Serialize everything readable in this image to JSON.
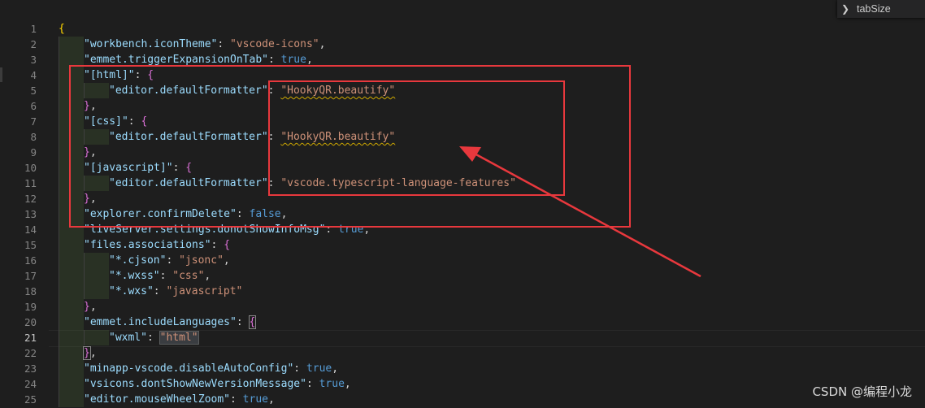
{
  "find_widget": {
    "query": "tabSize"
  },
  "lines": [
    {
      "n": "1",
      "indent": 0,
      "tokens": [
        {
          "t": "{",
          "c": "b1"
        }
      ]
    },
    {
      "n": "2",
      "indent": 1,
      "tokens": [
        {
          "t": "\"workbench.iconTheme\"",
          "c": "k"
        },
        {
          "t": ": ",
          "c": "p"
        },
        {
          "t": "\"vscode-icons\"",
          "c": "s"
        },
        {
          "t": ",",
          "c": "p"
        }
      ]
    },
    {
      "n": "3",
      "indent": 1,
      "tokens": [
        {
          "t": "\"emmet.triggerExpansionOnTab\"",
          "c": "k"
        },
        {
          "t": ": ",
          "c": "p"
        },
        {
          "t": "true",
          "c": "c"
        },
        {
          "t": ",",
          "c": "p"
        }
      ]
    },
    {
      "n": "4",
      "indent": 1,
      "tokens": [
        {
          "t": "\"[html]\"",
          "c": "k"
        },
        {
          "t": ": ",
          "c": "p"
        },
        {
          "t": "{",
          "c": "b2"
        }
      ]
    },
    {
      "n": "5",
      "indent": 2,
      "tokens": [
        {
          "t": "\"editor.defaultFormatter\"",
          "c": "k"
        },
        {
          "t": ": ",
          "c": "p"
        },
        {
          "t": "\"HookyQR.beautify\"",
          "c": "s squig"
        }
      ]
    },
    {
      "n": "6",
      "indent": 1,
      "tokens": [
        {
          "t": "}",
          "c": "b2"
        },
        {
          "t": ",",
          "c": "p"
        }
      ]
    },
    {
      "n": "7",
      "indent": 1,
      "tokens": [
        {
          "t": "\"[css]\"",
          "c": "k"
        },
        {
          "t": ": ",
          "c": "p"
        },
        {
          "t": "{",
          "c": "b2"
        }
      ]
    },
    {
      "n": "8",
      "indent": 2,
      "tokens": [
        {
          "t": "\"editor.defaultFormatter\"",
          "c": "k"
        },
        {
          "t": ": ",
          "c": "p"
        },
        {
          "t": "\"HookyQR.beautify\"",
          "c": "s squig"
        }
      ]
    },
    {
      "n": "9",
      "indent": 1,
      "tokens": [
        {
          "t": "}",
          "c": "b2"
        },
        {
          "t": ",",
          "c": "p"
        }
      ]
    },
    {
      "n": "10",
      "indent": 1,
      "tokens": [
        {
          "t": "\"[javascript]\"",
          "c": "k"
        },
        {
          "t": ": ",
          "c": "p"
        },
        {
          "t": "{",
          "c": "b2"
        }
      ]
    },
    {
      "n": "11",
      "indent": 2,
      "tokens": [
        {
          "t": "\"editor.defaultFormatter\"",
          "c": "k"
        },
        {
          "t": ": ",
          "c": "p"
        },
        {
          "t": "\"vscode.typescript-language-features\"",
          "c": "s"
        }
      ]
    },
    {
      "n": "12",
      "indent": 1,
      "tokens": [
        {
          "t": "}",
          "c": "b2"
        },
        {
          "t": ",",
          "c": "p"
        }
      ]
    },
    {
      "n": "13",
      "indent": 1,
      "tokens": [
        {
          "t": "\"explorer.confirmDelete\"",
          "c": "k"
        },
        {
          "t": ": ",
          "c": "p"
        },
        {
          "t": "false",
          "c": "c"
        },
        {
          "t": ",",
          "c": "p"
        }
      ]
    },
    {
      "n": "14",
      "indent": 1,
      "tokens": [
        {
          "t": "\"liveServer.settings.donotShowInfoMsg\"",
          "c": "k"
        },
        {
          "t": ": ",
          "c": "p"
        },
        {
          "t": "true",
          "c": "c"
        },
        {
          "t": ",",
          "c": "p"
        }
      ]
    },
    {
      "n": "15",
      "indent": 1,
      "tokens": [
        {
          "t": "\"files.associations\"",
          "c": "k"
        },
        {
          "t": ": ",
          "c": "p"
        },
        {
          "t": "{",
          "c": "b2"
        }
      ]
    },
    {
      "n": "16",
      "indent": 2,
      "tokens": [
        {
          "t": "\"*.cjson\"",
          "c": "k"
        },
        {
          "t": ": ",
          "c": "p"
        },
        {
          "t": "\"jsonc\"",
          "c": "s"
        },
        {
          "t": ",",
          "c": "p"
        }
      ]
    },
    {
      "n": "17",
      "indent": 2,
      "tokens": [
        {
          "t": "\"*.wxss\"",
          "c": "k"
        },
        {
          "t": ": ",
          "c": "p"
        },
        {
          "t": "\"css\"",
          "c": "s"
        },
        {
          "t": ",",
          "c": "p"
        }
      ]
    },
    {
      "n": "18",
      "indent": 2,
      "tokens": [
        {
          "t": "\"*.wxs\"",
          "c": "k"
        },
        {
          "t": ": ",
          "c": "p"
        },
        {
          "t": "\"javascript\"",
          "c": "s"
        }
      ]
    },
    {
      "n": "19",
      "indent": 1,
      "tokens": [
        {
          "t": "}",
          "c": "b2"
        },
        {
          "t": ",",
          "c": "p"
        }
      ]
    },
    {
      "n": "20",
      "indent": 1,
      "tokens": [
        {
          "t": "\"emmet.includeLanguages\"",
          "c": "k"
        },
        {
          "t": ": ",
          "c": "p"
        },
        {
          "t": "{",
          "c": "b2 bracket-match"
        }
      ]
    },
    {
      "n": "21",
      "indent": 2,
      "tokens": [
        {
          "t": "\"wxml\"",
          "c": "k"
        },
        {
          "t": ": ",
          "c": "p"
        },
        {
          "t": "\"html\"",
          "c": "s hl-box"
        }
      ],
      "caret": true
    },
    {
      "n": "22",
      "indent": 1,
      "tokens": [
        {
          "t": "}",
          "c": "b2 bracket-match"
        },
        {
          "t": ",",
          "c": "p"
        }
      ]
    },
    {
      "n": "23",
      "indent": 1,
      "tokens": [
        {
          "t": "\"minapp-vscode.disableAutoConfig\"",
          "c": "k"
        },
        {
          "t": ": ",
          "c": "p"
        },
        {
          "t": "true",
          "c": "c"
        },
        {
          "t": ",",
          "c": "p"
        }
      ]
    },
    {
      "n": "24",
      "indent": 1,
      "tokens": [
        {
          "t": "\"vsicons.dontShowNewVersionMessage\"",
          "c": "k"
        },
        {
          "t": ": ",
          "c": "p"
        },
        {
          "t": "true",
          "c": "c"
        },
        {
          "t": ",",
          "c": "p"
        }
      ]
    },
    {
      "n": "25",
      "indent": 1,
      "tokens": [
        {
          "t": "\"editor.mouseWheelZoom\"",
          "c": "k"
        },
        {
          "t": ": ",
          "c": "p"
        },
        {
          "t": "true",
          "c": "c"
        },
        {
          "t": ",",
          "c": "p"
        }
      ]
    }
  ],
  "active_line": "21",
  "watermark": "CSDN @编程小龙",
  "annotation_color": "#e8383d"
}
